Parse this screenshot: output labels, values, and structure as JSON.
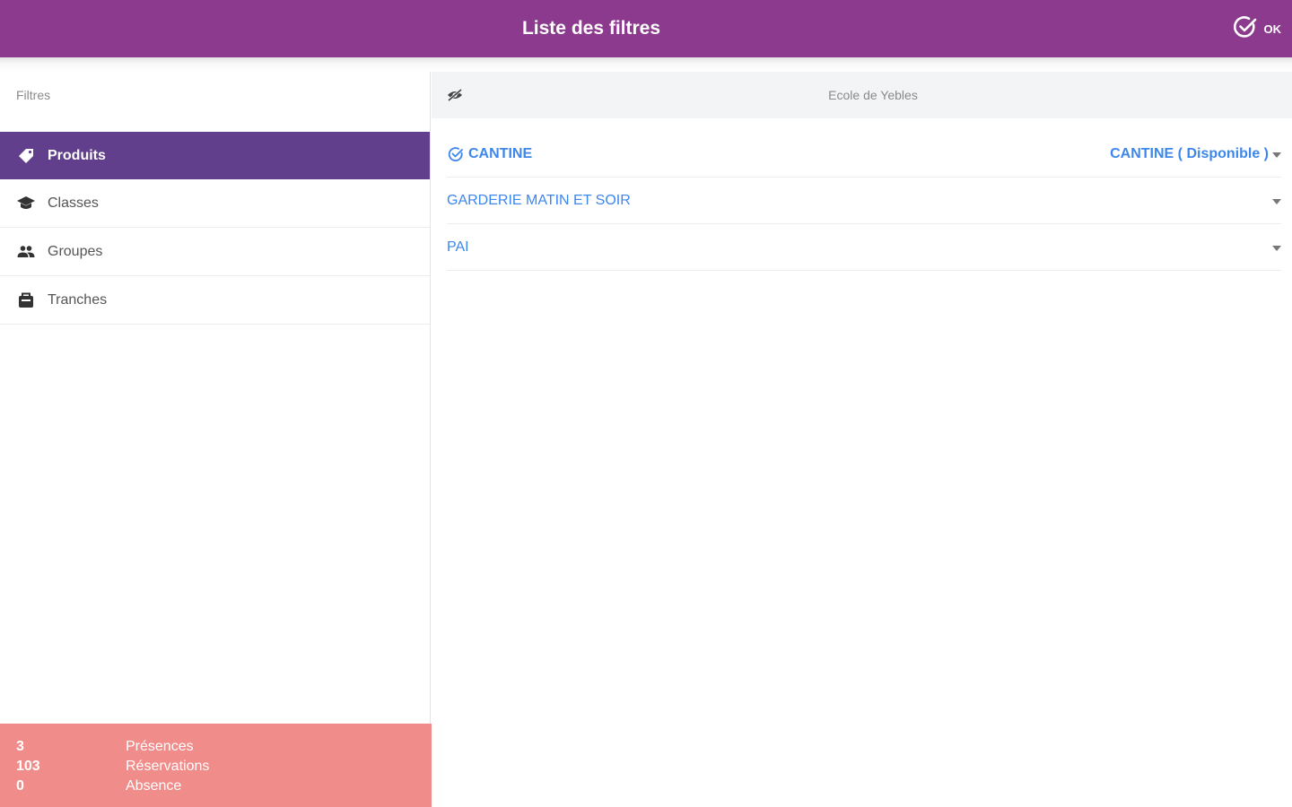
{
  "appbar": {
    "title": "Liste des filtres",
    "ok_label": "OK"
  },
  "left": {
    "header": "Filtres",
    "items": [
      {
        "label": "Produits",
        "icon": "tag-icon",
        "active": true
      },
      {
        "label": "Classes",
        "icon": "graduation-cap-icon",
        "active": false
      },
      {
        "label": "Groupes",
        "icon": "people-icon",
        "active": false
      },
      {
        "label": "Tranches",
        "icon": "lunch-box-icon",
        "active": false
      }
    ]
  },
  "stats": [
    {
      "value": "3",
      "label": "Présences"
    },
    {
      "value": "103",
      "label": "Réservations"
    },
    {
      "value": "0",
      "label": "Absence"
    }
  ],
  "right": {
    "school": "Ecole de Yebles",
    "products": [
      {
        "name": "CANTINE",
        "selected": true,
        "value": "CANTINE ( Disponible )"
      },
      {
        "name": "GARDERIE MATIN ET SOIR",
        "selected": false,
        "value": ""
      },
      {
        "name": "PAI",
        "selected": false,
        "value": ""
      }
    ]
  },
  "colors": {
    "appbar": "#8b3a8d",
    "active_nav": "#623f8d",
    "stats_bg": "#f08c8a",
    "link_blue": "#3d86ea"
  }
}
